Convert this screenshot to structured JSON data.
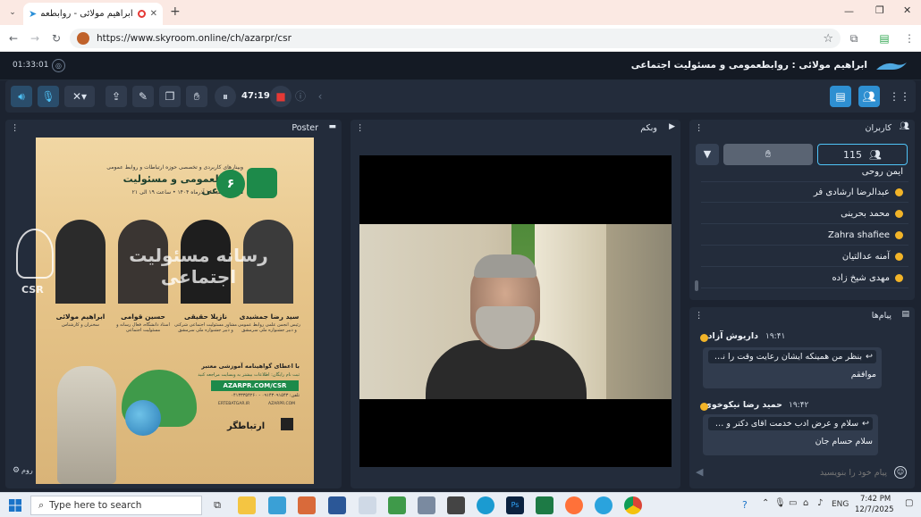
{
  "browser": {
    "tab_title": "ابراهیم مولائی - روابطعمومی",
    "url": "https://www.skyroom.online/ch/azarpr/csr"
  },
  "app": {
    "elapsed_time": "01:33:01",
    "room_title": "ابراهیم مولائی : روابطعمومی و مسئولیت اجتماعی"
  },
  "toolbar": {
    "timer": "47:19"
  },
  "poster_panel": {
    "title": "Poster",
    "logo_number": "۶",
    "series_text": "وبینارهای کاربردی و تخصصی حوزه ارتباطات و روابط عمومی",
    "headline": "روابطعمومی و مسئولیت اجتماعی",
    "date_line": "تاریخ: یکشنبه ۱۶ آذرماه ۱۴۰۴ • ساعت ۱۹ الی ۲۱",
    "watermark": "رسانه مسئولیت اجتماعی",
    "watermark_sub": "CSR",
    "speakers": [
      {
        "name": "ابراهیم مولائی",
        "role": "سخنران و کارشناس"
      },
      {
        "name": "حسین قوامی",
        "role": "استاد دانشگاه، فعال رسانه و مسئولیت اجتماعی"
      },
      {
        "name": "نازیلا حقیقی",
        "role": "مشاور مسئولیت اجتماعی شرکتی و دبیر جشنواره ملی سرمشق"
      },
      {
        "name": "سید رضا جمشیدی",
        "role": "رئیس انجمن علمی روابط عمومی و دبیر جشنواره ملی سرمشق"
      }
    ],
    "certificate_text": "با اعطای گواهینامه آموزشی معتبر",
    "register_text": "ثبت نام رایگان: اطلاعات بیشتر به وبسایت مراجعه کنید",
    "site_url": "AZARPR.COM/CSR",
    "phone": "تلفن: ۰۹۱۴۳۰۹۱۵۴۳ - ۰۴۱۳۳۳۵۴۲۶۰",
    "footer_left": "ERTEBATGAR.IR",
    "footer_right": "AZARPR.COM",
    "brand": "ارتباطگر"
  },
  "webcam_panel": {
    "title": "وبکم"
  },
  "users_panel": {
    "title": "کاربران",
    "user_count": "115",
    "users": [
      "ایمن روحی",
      "عبدالرضا ارشادی فر",
      "محمد بحرینی",
      "Zahra shafiee",
      "آمنه عدالتیان",
      "مهدی شیخ زاده"
    ]
  },
  "messages_panel": {
    "title": "پیام‌ها",
    "input_placeholder": "پیام خود را بنویسید",
    "messages": [
      {
        "sender": "داریوش آزاد",
        "time": "۱۹:۴۱",
        "reply": "بنظر من همینکه ایشان رعایت وقت را نمی کنند، یعنی...",
        "text": "موافقم"
      },
      {
        "sender": "حمید رضا نیکوخوی",
        "time": "۱۹:۴۲",
        "reply": "سلام و عرض ادب خدمت آقای دکتر و همه عزیزان",
        "text": "سلام حسام جان"
      }
    ]
  },
  "taskbar": {
    "search_placeholder": "Type here to search",
    "lang": "ENG",
    "time": "7:42 PM",
    "date": "12/7/2025"
  },
  "colors": {
    "accent": "#4fc3f7",
    "panel_bg": "#232c3b",
    "app_bg": "#1c2330",
    "user_icon": "#f2b428",
    "record": "#e53935"
  }
}
